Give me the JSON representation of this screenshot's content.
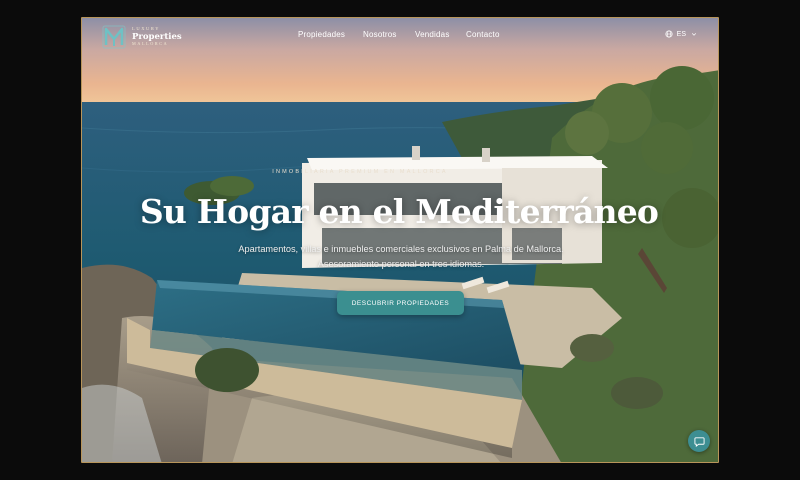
{
  "brand": {
    "top": "LUXURY",
    "main": "Properties",
    "bottom": "MALLORCA",
    "logo_icon": "luxury-properties-logo-icon"
  },
  "nav": {
    "items": [
      {
        "label": "Propiedades"
      },
      {
        "label": "Nosotros"
      },
      {
        "label": "Vendidas"
      },
      {
        "label": "Contacto"
      }
    ]
  },
  "language": {
    "current": "ES",
    "icon": "globe-icon"
  },
  "hero": {
    "eyebrow": "INMOBILIARIA PREMIUM EN MALLORCA",
    "title": "Su Hogar en el Mediterráneo",
    "subtitle": "Apartamentos, villas e inmuebles comerciales exclusivos en Palma de Mallorca. Asesoramiento personal en tres idiomas.",
    "cta": "DESCUBRIR PROPIEDADES"
  },
  "chat": {
    "icon": "chat-bubble-icon"
  },
  "colors": {
    "accent": "#3b8f90",
    "frame": "#b8955a"
  }
}
